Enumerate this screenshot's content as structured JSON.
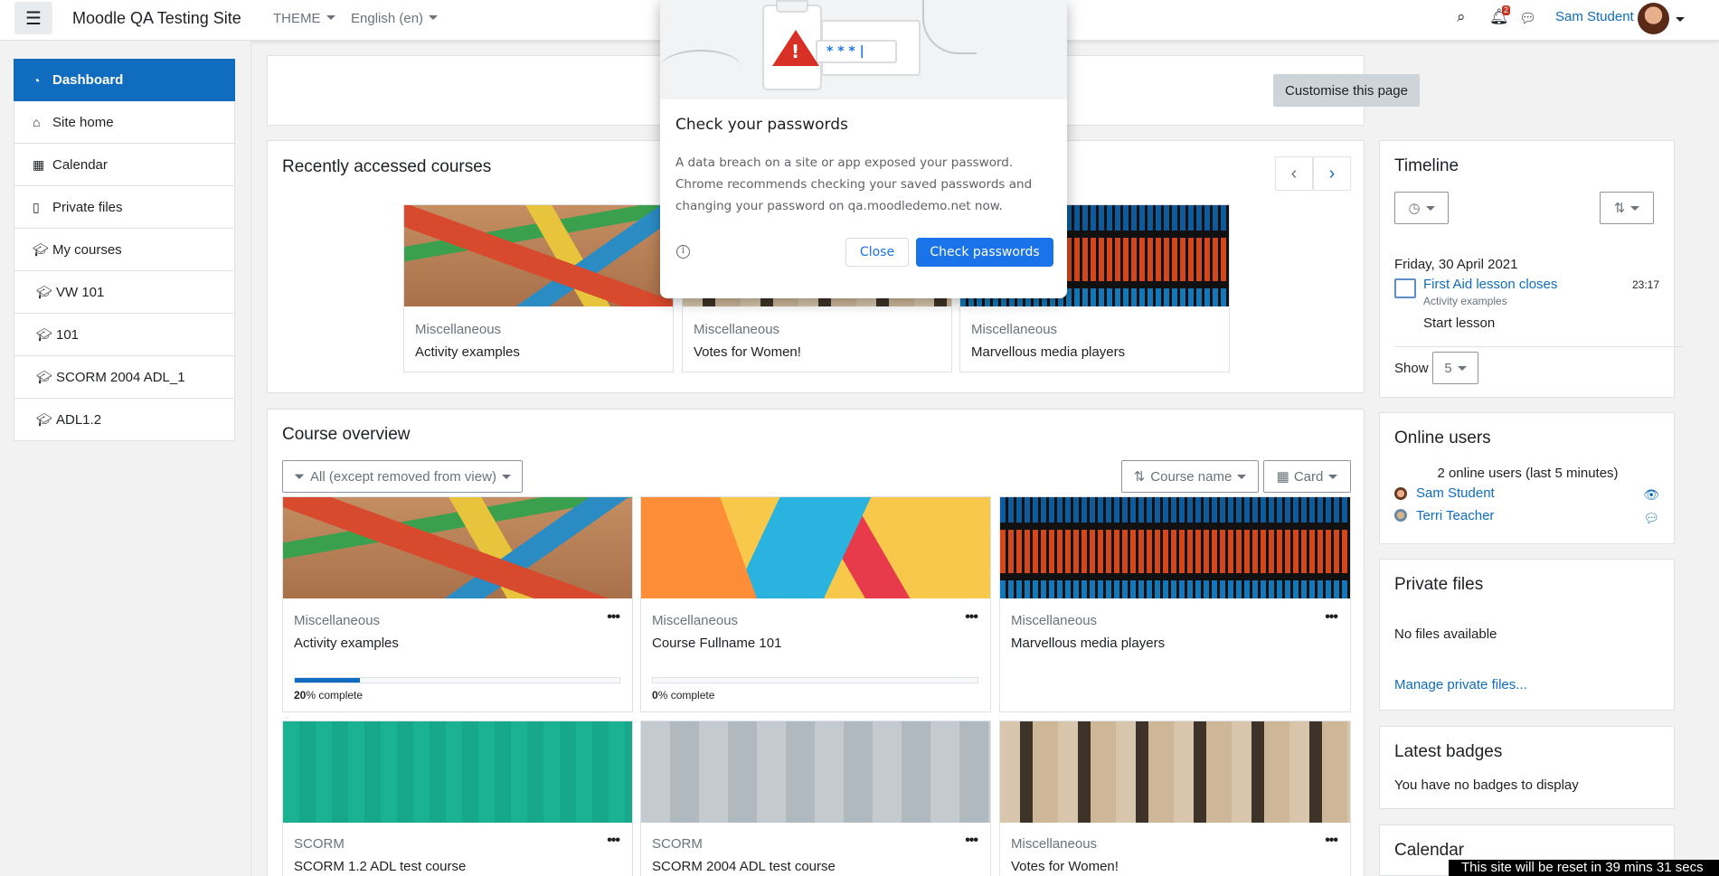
{
  "navbar": {
    "site_name": "Moodle QA Testing Site",
    "theme_label": "THEME",
    "language_label": "English (en)",
    "notification_count": "2",
    "user_name": "Sam Student"
  },
  "drawer": {
    "items": [
      {
        "label": "Dashboard"
      },
      {
        "label": "Site home"
      },
      {
        "label": "Calendar"
      },
      {
        "label": "Private files"
      },
      {
        "label": "My courses"
      },
      {
        "label": "VW 101"
      },
      {
        "label": "101"
      },
      {
        "label": "SCORM 2004 ADL_1"
      },
      {
        "label": "ADL1.2"
      }
    ]
  },
  "header": {
    "customise_label": "Customise this page"
  },
  "recent": {
    "title": "Recently accessed courses",
    "courses": [
      {
        "category": "Miscellaneous",
        "name": "Activity examples"
      },
      {
        "category": "Miscellaneous",
        "name": "Votes for Women!"
      },
      {
        "category": "Miscellaneous",
        "name": "Marvellous media players"
      }
    ]
  },
  "overview": {
    "title": "Course overview",
    "filter_label": "All (except removed from view)",
    "sort_label": "Course name",
    "view_label": "Card",
    "courses": [
      {
        "category": "Miscellaneous",
        "name": "Activity examples",
        "progress_value": "20",
        "progress_suffix": "% complete",
        "progress": 0.2
      },
      {
        "category": "Miscellaneous",
        "name": "Course Fullname 101",
        "progress_value": "0",
        "progress_suffix": "% complete",
        "progress": 0.0
      },
      {
        "category": "Miscellaneous",
        "name": "Marvellous media players"
      },
      {
        "category": "SCORM",
        "name": "SCORM 1.2 ADL test course"
      },
      {
        "category": "SCORM",
        "name": "SCORM 2004 ADL test course"
      },
      {
        "category": "Miscellaneous",
        "name": "Votes for Women!"
      }
    ]
  },
  "timeline": {
    "title": "Timeline",
    "date": "Friday, 30 April 2021",
    "event_name": "First Aid lesson closes",
    "event_course": "Activity examples",
    "event_time": "23:17",
    "event_action": "Start lesson",
    "show_label": "Show",
    "show_value": "5"
  },
  "online_users": {
    "title": "Online users",
    "summary": "2 online users (last 5 minutes)",
    "users": [
      "Sam Student",
      "Terri Teacher"
    ]
  },
  "private_files": {
    "title": "Private files",
    "empty": "No files available",
    "manage_link": "Manage private files..."
  },
  "badges": {
    "title": "Latest badges",
    "empty": "You have no badges to display"
  },
  "calendar": {
    "title": "Calendar"
  },
  "password_popup": {
    "field_text": "* * * |",
    "title": "Check your passwords",
    "body": "A data breach on a site or app exposed your password. Chrome recommends checking your saved passwords and changing your password on qa.moodledemo.net now.",
    "close_label": "Close",
    "check_label": "Check passwords"
  },
  "reset_notice": "This site will be reset in 39 mins 31 secs"
}
